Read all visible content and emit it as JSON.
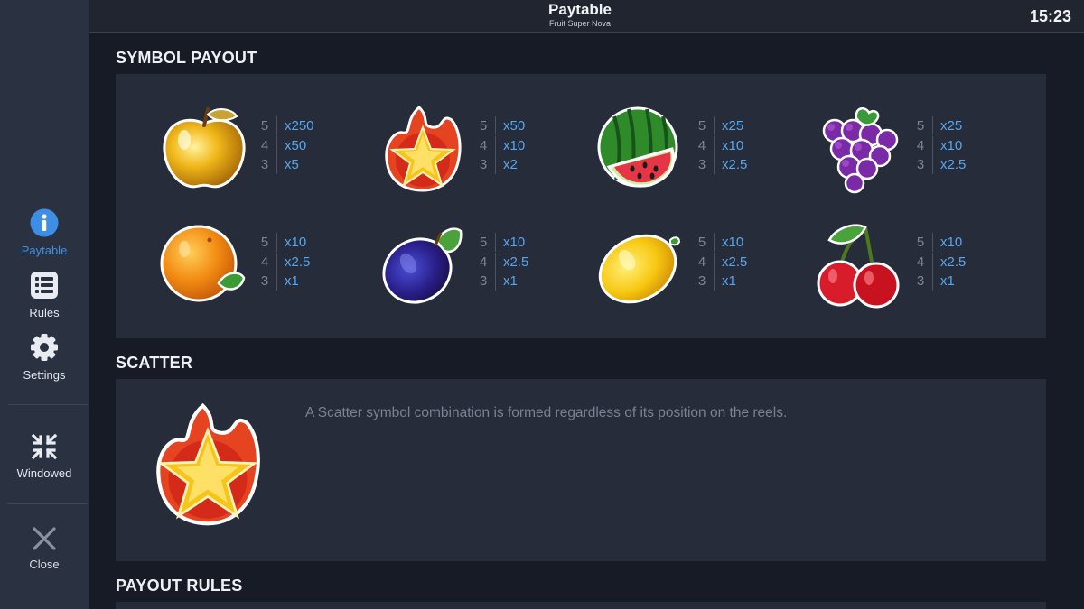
{
  "header": {
    "title": "Paytable",
    "subtitle": "Fruit Super Nova",
    "time": "15:23"
  },
  "sidebar": {
    "items": [
      {
        "label": "Paytable",
        "icon": "info-icon",
        "active": true
      },
      {
        "label": "Rules",
        "icon": "list-icon"
      },
      {
        "label": "Settings",
        "icon": "gear-icon"
      },
      {
        "label": "Windowed",
        "icon": "windowed-icon"
      },
      {
        "label": "Close",
        "icon": "close-icon"
      }
    ]
  },
  "sections": {
    "symbol_payout": "SYMBOL PAYOUT",
    "scatter": "SCATTER",
    "payout_rules": "PAYOUT RULES"
  },
  "symbols": [
    {
      "name": "golden-apple",
      "pays": [
        {
          "n": "5",
          "v": "x250"
        },
        {
          "n": "4",
          "v": "x50"
        },
        {
          "n": "3",
          "v": "x5"
        }
      ]
    },
    {
      "name": "star",
      "pays": [
        {
          "n": "5",
          "v": "x50"
        },
        {
          "n": "4",
          "v": "x10"
        },
        {
          "n": "3",
          "v": "x2"
        }
      ]
    },
    {
      "name": "watermelon",
      "pays": [
        {
          "n": "5",
          "v": "x25"
        },
        {
          "n": "4",
          "v": "x10"
        },
        {
          "n": "3",
          "v": "x2.5"
        }
      ]
    },
    {
      "name": "grapes",
      "pays": [
        {
          "n": "5",
          "v": "x25"
        },
        {
          "n": "4",
          "v": "x10"
        },
        {
          "n": "3",
          "v": "x2.5"
        }
      ]
    },
    {
      "name": "orange",
      "pays": [
        {
          "n": "5",
          "v": "x10"
        },
        {
          "n": "4",
          "v": "x2.5"
        },
        {
          "n": "3",
          "v": "x1"
        }
      ]
    },
    {
      "name": "plum",
      "pays": [
        {
          "n": "5",
          "v": "x10"
        },
        {
          "n": "4",
          "v": "x2.5"
        },
        {
          "n": "3",
          "v": "x1"
        }
      ]
    },
    {
      "name": "lemon",
      "pays": [
        {
          "n": "5",
          "v": "x10"
        },
        {
          "n": "4",
          "v": "x2.5"
        },
        {
          "n": "3",
          "v": "x1"
        }
      ]
    },
    {
      "name": "cherries",
      "pays": [
        {
          "n": "5",
          "v": "x10"
        },
        {
          "n": "4",
          "v": "x2.5"
        },
        {
          "n": "3",
          "v": "x1"
        }
      ]
    }
  ],
  "scatter": {
    "description": "A Scatter symbol combination is formed regardless of its position on the reels."
  },
  "colors": {
    "accent": "#3d8fe6",
    "payout_value": "#58a6ef"
  }
}
